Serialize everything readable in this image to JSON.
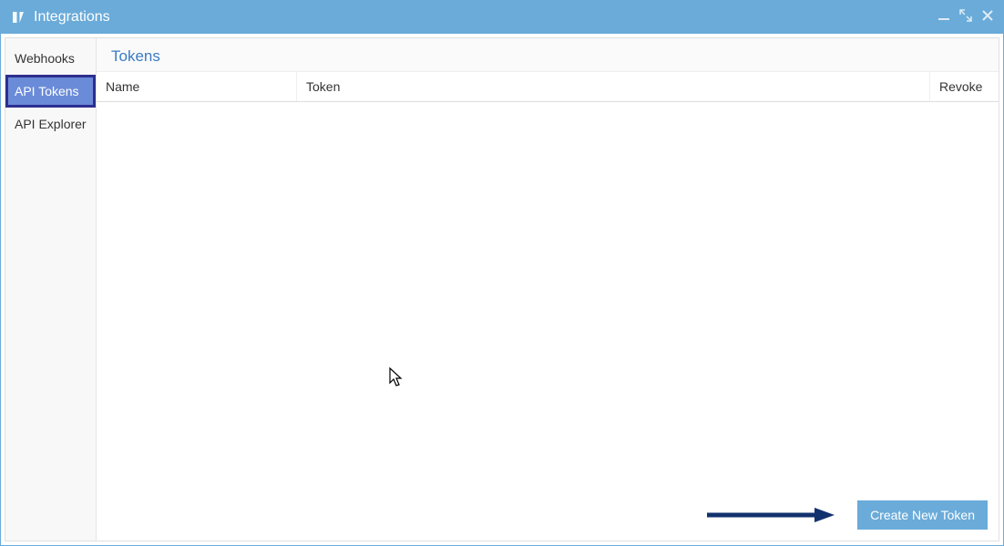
{
  "window": {
    "title": "Integrations"
  },
  "sidebar": {
    "items": [
      {
        "label": "Webhooks",
        "active": false
      },
      {
        "label": "API Tokens",
        "active": true
      },
      {
        "label": "API Explorer",
        "active": false
      }
    ]
  },
  "main": {
    "heading": "Tokens",
    "columns": {
      "name": "Name",
      "token": "Token",
      "revoke": "Revoke"
    },
    "rows": [],
    "create_button": "Create New Token"
  }
}
